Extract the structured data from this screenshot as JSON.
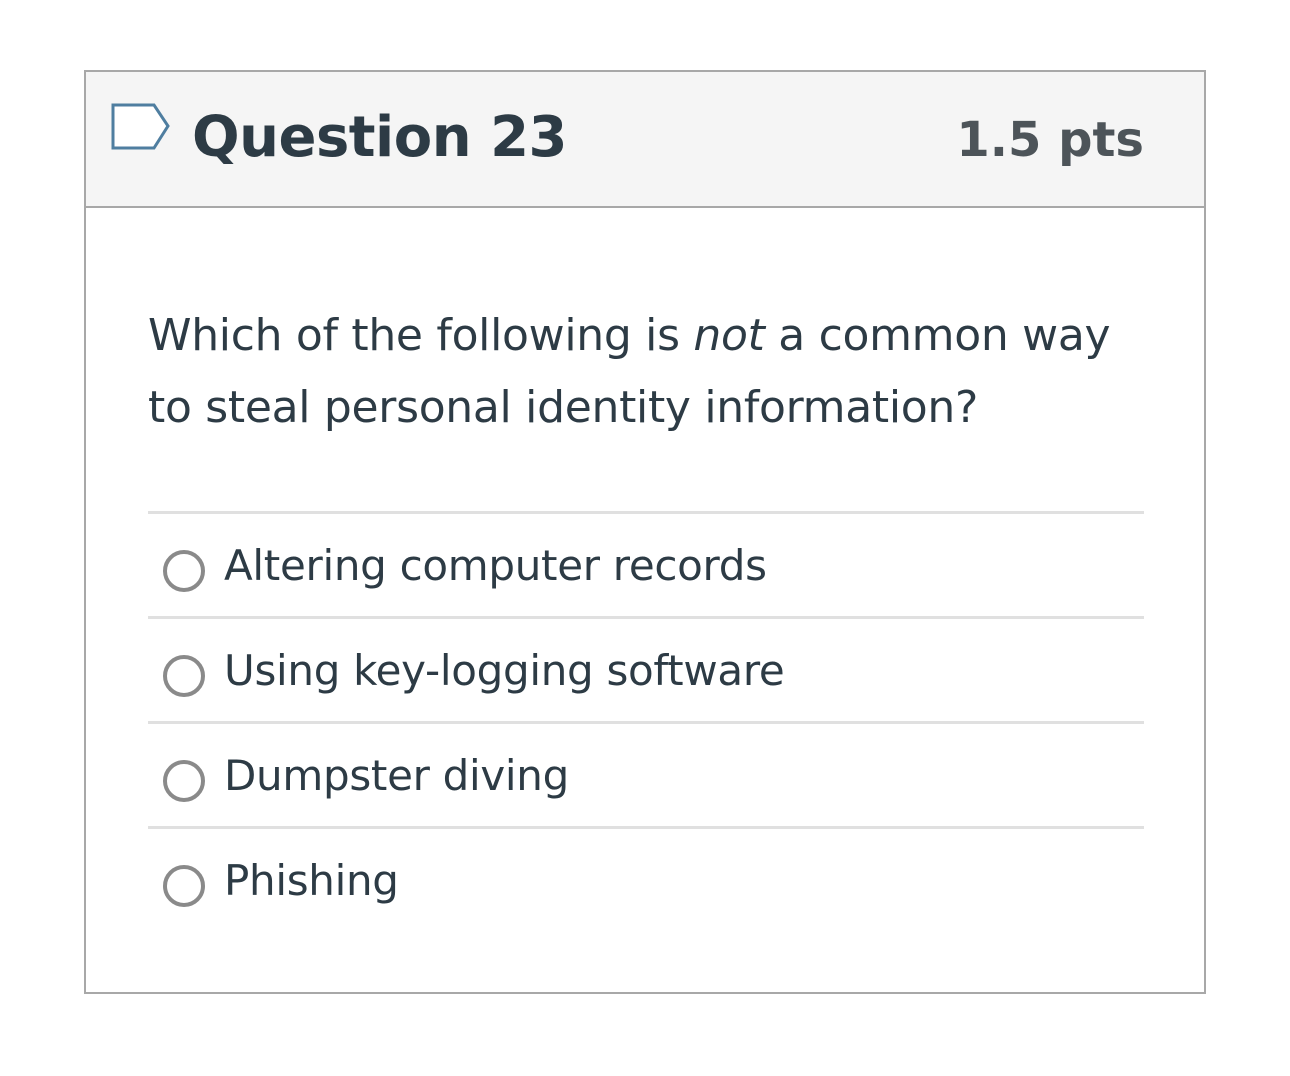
{
  "question": {
    "title": "Question 23",
    "points": "1.5 pts",
    "flag_icon": "flag-outline-icon",
    "text_before": "Which of the following is ",
    "text_emphasis": "not",
    "text_after": " a common way to steal personal identity information?"
  },
  "answers": [
    {
      "label": "Altering computer records",
      "selected": false
    },
    {
      "label": "Using key-logging software",
      "selected": false
    },
    {
      "label": "Dumpster diving",
      "selected": false
    },
    {
      "label": "Phishing",
      "selected": false
    }
  ],
  "colors": {
    "header_bg": "#f5f5f5",
    "border": "#a8a8a8",
    "divider": "#e0e0e0",
    "text": "#2d3b45",
    "points_text": "#4d5459",
    "flag_stroke": "#4f7ea0",
    "radio_border": "#8a8a8a"
  }
}
